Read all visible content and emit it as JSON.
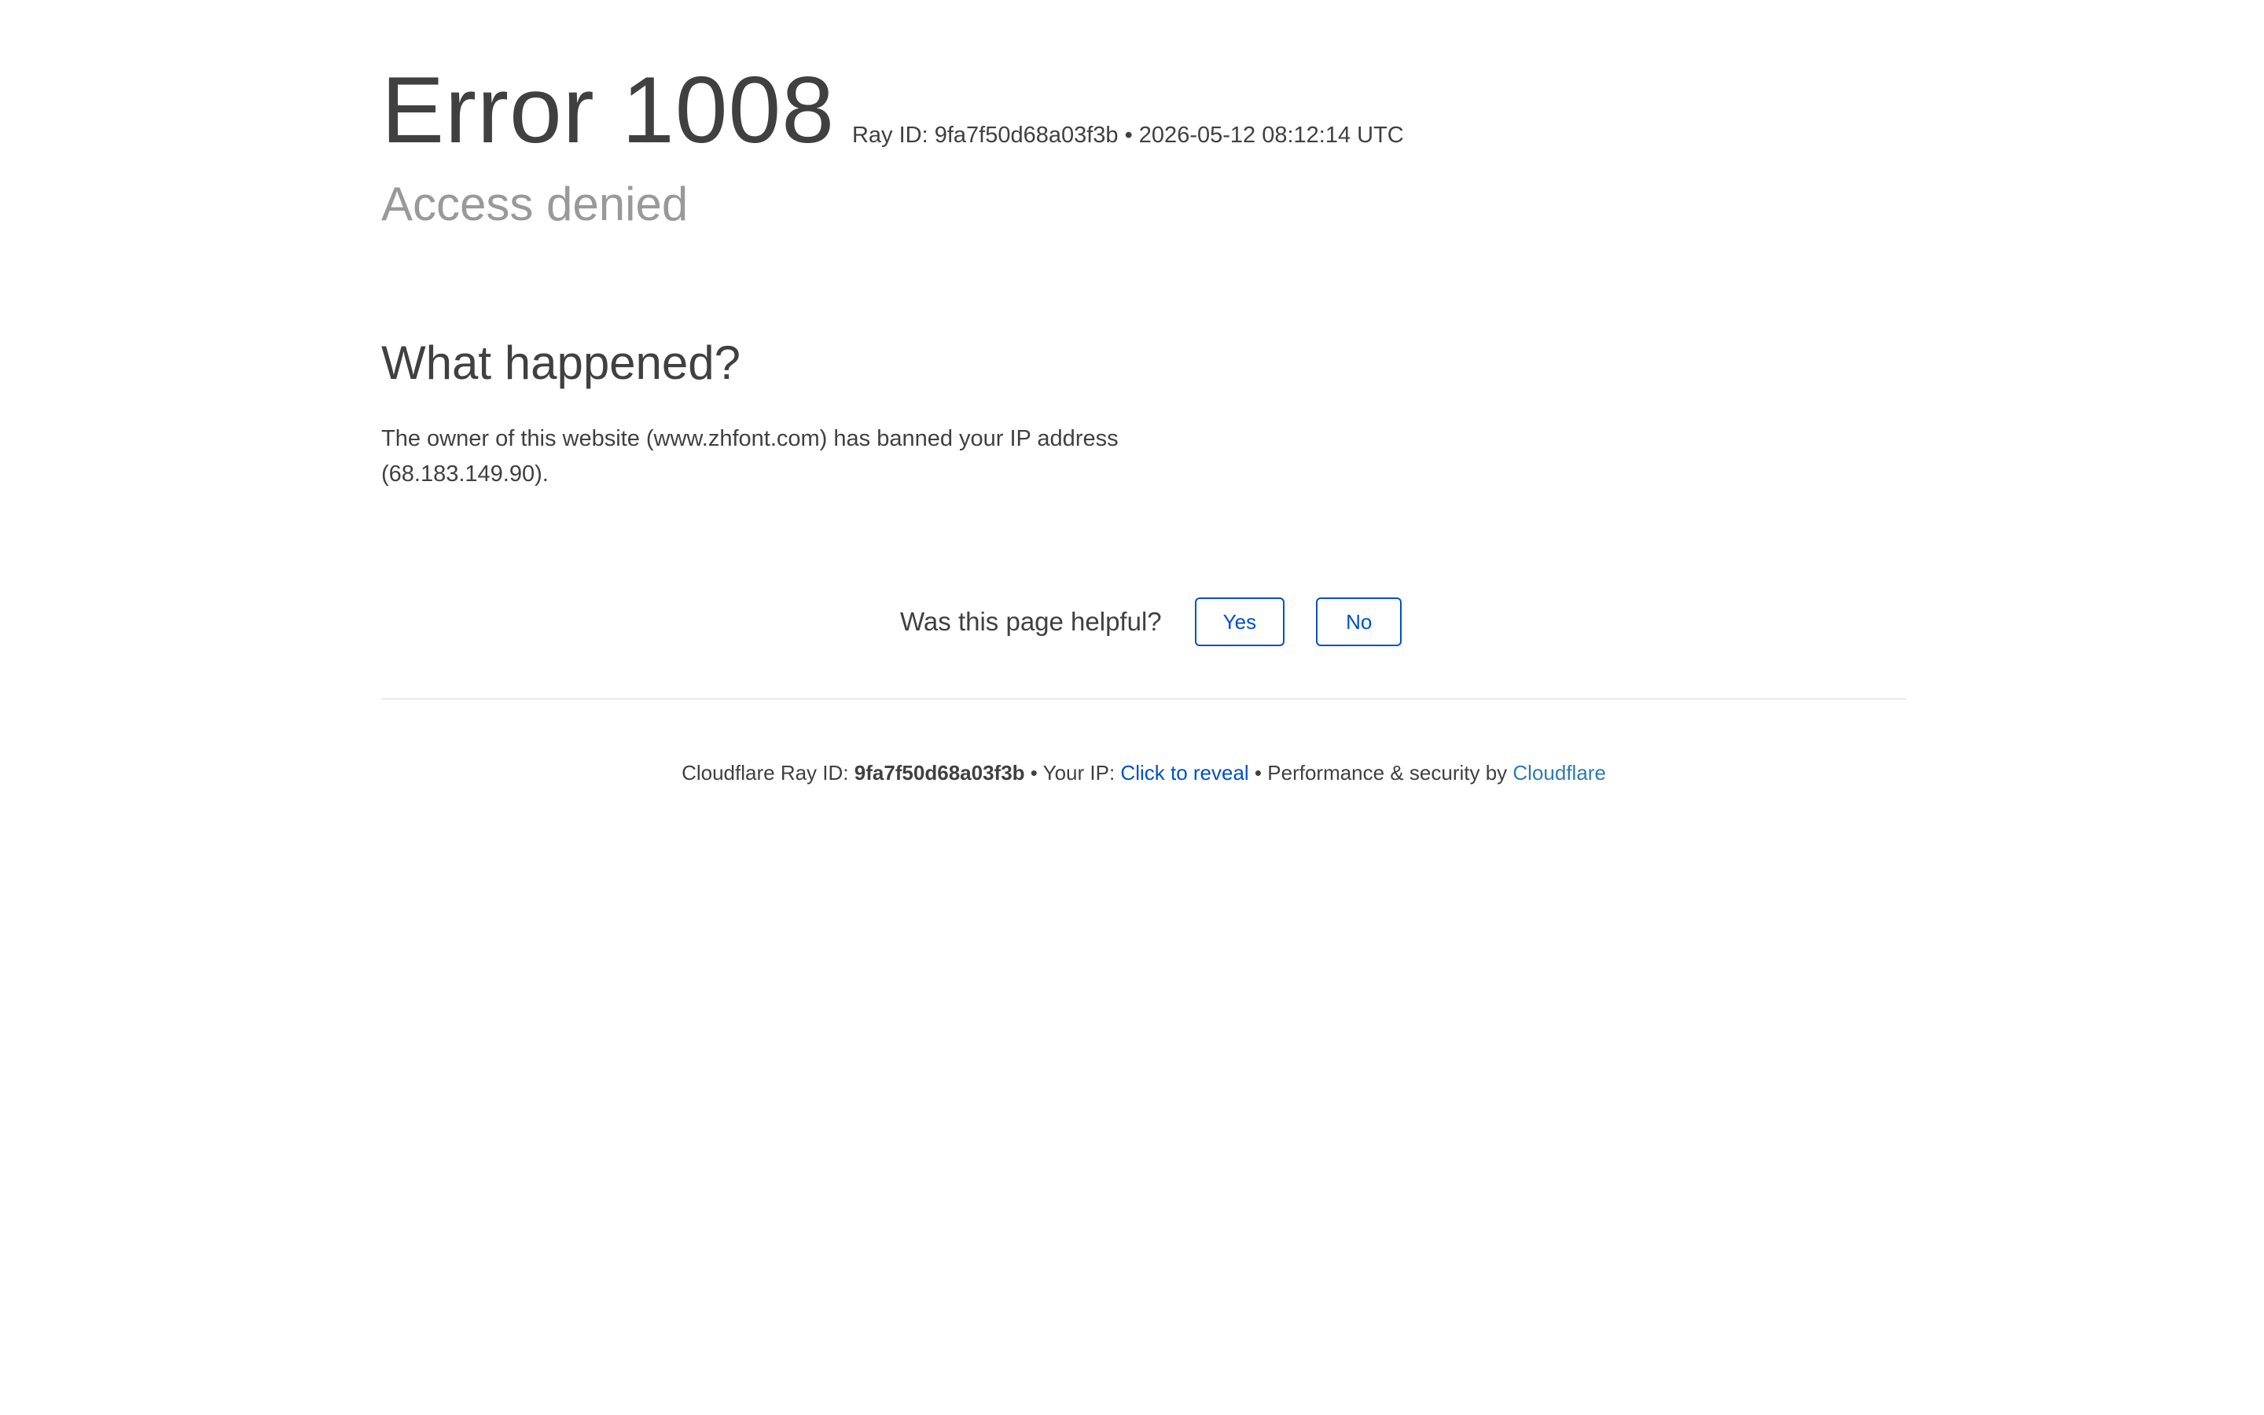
{
  "header": {
    "error_title": "Error 1008",
    "ray_meta": "Ray ID: 9fa7f50d68a03f3b • 2026-05-12 08:12:14 UTC",
    "subtitle": "Access denied"
  },
  "main": {
    "section_title": "What happened?",
    "body_text": "The owner of this website (www.zhfont.com) has banned your IP address (68.183.149.90)."
  },
  "feedback": {
    "label": "Was this page helpful?",
    "yes_label": "Yes",
    "no_label": "No"
  },
  "footer": {
    "ray_label": "Cloudflare Ray ID: ",
    "ray_id": "9fa7f50d68a03f3b",
    "sep1": " • ",
    "ip_label": "Your IP: ",
    "reveal_label": "Click to reveal",
    "sep2": " • ",
    "perf_label": "Performance & security by ",
    "cloudflare_link": "Cloudflare"
  },
  "colors": {
    "text": "#404040",
    "muted": "#999999",
    "link_blue": "#0051c3",
    "footer_link": "#2c7cb0"
  }
}
